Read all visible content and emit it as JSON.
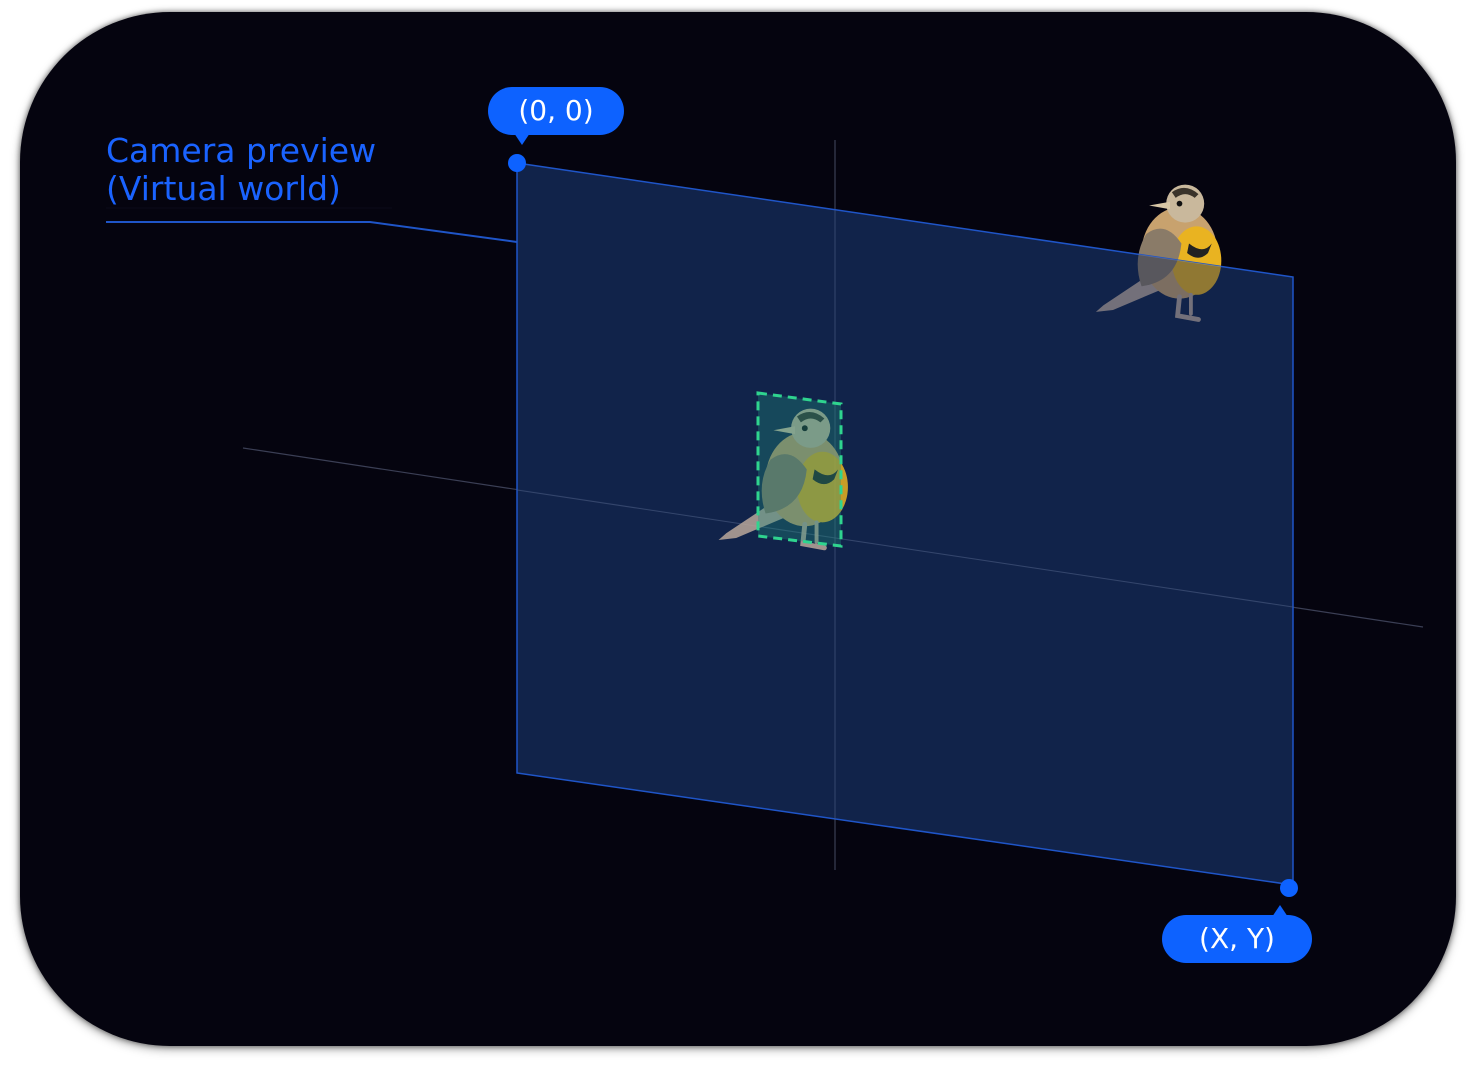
{
  "diagram": {
    "label_lines": [
      "Camera preview",
      "(Virtual world)"
    ],
    "origin_label": "(0,  0)",
    "corner_label": "(X,  Y)",
    "colors": {
      "background": "#05040f",
      "accent": "#0d62ff",
      "plane_fill": "#12264f",
      "plane_edge": "#1f55c8",
      "bbox_stroke": "#2fd48f",
      "axis_line": "#3b3f55",
      "label_text": "#1a63ff",
      "bubble_text": "#ffffff"
    },
    "icons": [
      "bird-illustration",
      "bounding-box",
      "corner-point-marker"
    ]
  }
}
